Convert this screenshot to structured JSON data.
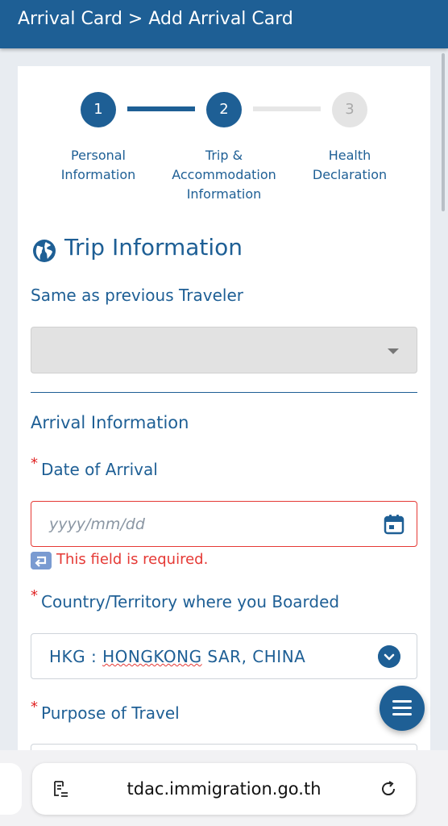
{
  "header": {
    "title": "Arrival Card > Add Arrival Card"
  },
  "stepper": {
    "steps": [
      {
        "number": "1",
        "label_line1": "Personal",
        "label_line2": "Information",
        "label_line3": "",
        "state": "active"
      },
      {
        "number": "2",
        "label_line1": "Trip &",
        "label_line2": "Accommodation",
        "label_line3": "Information",
        "state": "active"
      },
      {
        "number": "3",
        "label_line1": "Health",
        "label_line2": "Declaration",
        "label_line3": "",
        "state": "inactive"
      }
    ]
  },
  "section": {
    "title": "Trip Information",
    "icon": "globe-icon"
  },
  "same_as_previous": {
    "label": "Same as previous Traveler",
    "value": ""
  },
  "arrival": {
    "title": "Arrival Information",
    "required_mark": "*",
    "date_label": "Date of Arrival",
    "date_placeholder": "yyyy/mm/dd",
    "error_text": "This field is required.",
    "country_label": "Country/Territory where you Boarded",
    "country_value_prefix": "HKG : ",
    "country_value_underlined": "HONGKONG",
    "country_value_suffix": " SAR, CHINA",
    "purpose_label": "Purpose of Travel"
  },
  "browser": {
    "url": "tdac.immigration.go.th"
  },
  "colors": {
    "primary": "#1e5f95",
    "error": "#e53935",
    "inactive": "#e4e4e4"
  }
}
